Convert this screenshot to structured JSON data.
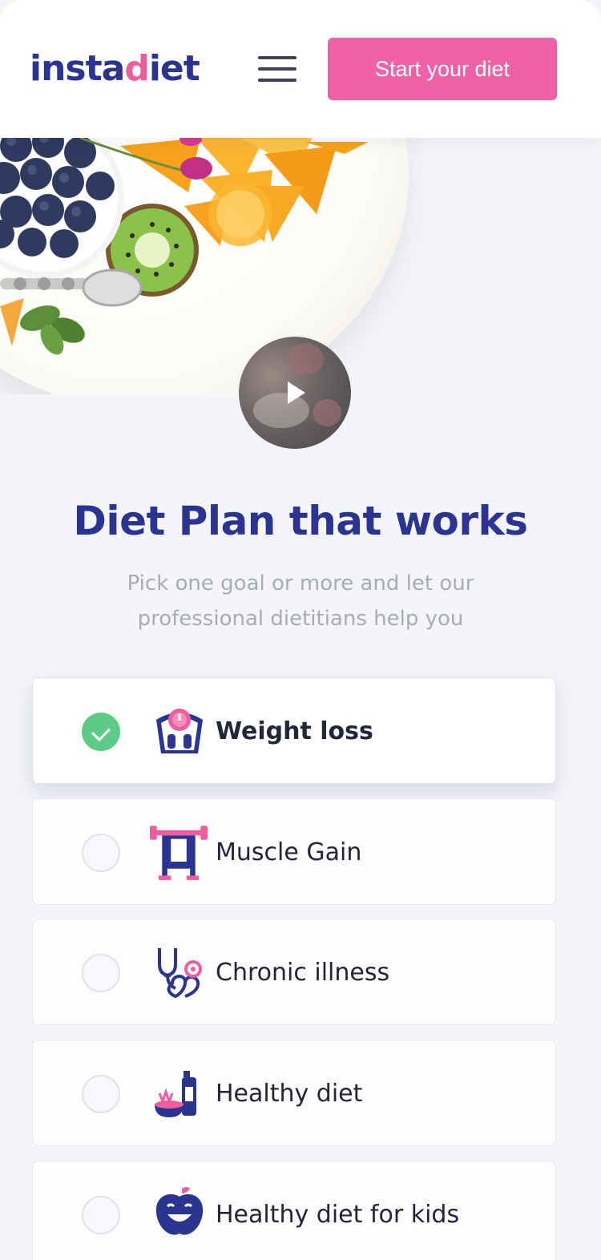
{
  "header": {
    "logo_main": "insta",
    "logo_accent": "d",
    "logo_tail": "iet",
    "cta_label": "Start your diet"
  },
  "hero": {
    "video_icon": "play-icon"
  },
  "main": {
    "title": "Diet Plan that works",
    "subtitle": "Pick one goal or more and let our professional dietitians help you"
  },
  "goals": [
    {
      "label": "Weight loss",
      "icon": "scale-icon",
      "selected": true
    },
    {
      "label": "Muscle Gain",
      "icon": "dumbbell-icon",
      "selected": false
    },
    {
      "label": "Chronic illness",
      "icon": "stethoscope-icon",
      "selected": false
    },
    {
      "label": "Healthy diet",
      "icon": "food-bottle-icon",
      "selected": false
    },
    {
      "label": "Healthy diet for kids",
      "icon": "apple-smile-icon",
      "selected": false
    }
  ],
  "colors": {
    "brand": "#2b3591",
    "accent": "#f062a6",
    "check": "#5ccb87",
    "background": "#f4f5f8"
  }
}
